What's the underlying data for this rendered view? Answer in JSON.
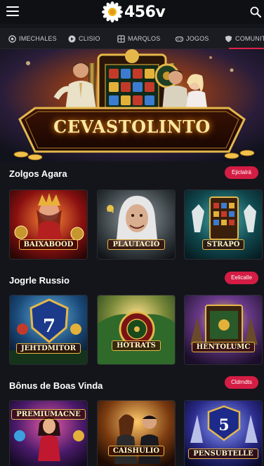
{
  "header": {
    "logo_text": "456v"
  },
  "categories": [
    {
      "label": "IMECHALES",
      "icon": "chip-icon"
    },
    {
      "label": "CLISIO",
      "icon": "play-icon"
    },
    {
      "label": "MARQLOS",
      "icon": "grid-icon"
    },
    {
      "label": "JOGOS",
      "icon": "gamepad-icon"
    },
    {
      "label": "COMUNITY",
      "icon": "shield-icon"
    }
  ],
  "hero": {
    "title": "CEVASTOLINTO"
  },
  "sections": [
    {
      "title": "Zolgos Agara",
      "pill": "Ejiclalrá",
      "tiles": [
        {
          "label": "BAIXABOOD"
        },
        {
          "label": "PLAUTACIO"
        },
        {
          "label": "STRAPO"
        }
      ]
    },
    {
      "title": "Jogrle Russio",
      "pill": "Eelicalle",
      "tiles": [
        {
          "label": "JEHTDMITOR"
        },
        {
          "label": "HOTRATS"
        },
        {
          "label": "HENTOLUMC"
        }
      ]
    },
    {
      "title": "Bônus de Boas Vinda",
      "pill": "Cldrndts",
      "tiles": [
        {
          "label": "PREMIUMACNE"
        },
        {
          "label": "CAISHULIO"
        },
        {
          "label": "PENSUBTELLE"
        }
      ]
    }
  ],
  "colors": {
    "accent": "#d41d44",
    "background": "#14151a",
    "gold": "#e5b84a"
  }
}
